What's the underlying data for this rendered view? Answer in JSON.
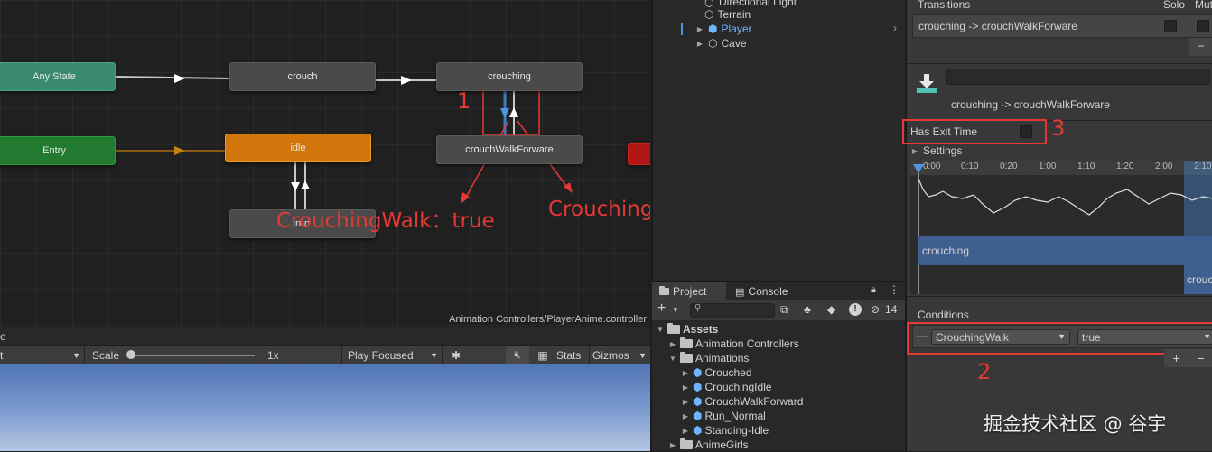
{
  "animator": {
    "path": "Animation Controllers/PlayerAnime.controller",
    "states": {
      "any_state": "Any State",
      "entry": "Entry",
      "crouch": "crouch",
      "idle": "idle",
      "crouching": "crouching",
      "crouch_walk_forward": "crouchWalkForware",
      "run": "run"
    },
    "annotations": {
      "marker_1": "1",
      "label_true": "CrouchingWalk：true",
      "label_false": "CrouchingWalk：false"
    },
    "colors": {
      "annotation": "#e53935",
      "default_state": "#d2760c",
      "any_state": "#3a8a72",
      "entry": "#217a2f"
    }
  },
  "hierarchy": {
    "items": [
      {
        "label": "Directional Light"
      },
      {
        "label": "Terrain"
      },
      {
        "label": "Player",
        "selected": true
      },
      {
        "label": "Cave"
      }
    ]
  },
  "project": {
    "tabs": [
      "Project",
      "Console"
    ],
    "hidden_count": "14",
    "tree": {
      "root": "Assets",
      "folders": [
        "Animation Controllers",
        "Animations",
        "AnimeGirls"
      ],
      "animations": [
        "Crouched",
        "CrouchingIdle",
        "CrouchWalkForward",
        "Run_Normal",
        "Standing-Idle"
      ]
    }
  },
  "inspector": {
    "transitions_header": "Transitions",
    "solo_label": "Solo",
    "mute_label": "Mut",
    "transition_row": "crouching -> crouchWalkForware",
    "transition_name": "crouching -> crouchWalkForware",
    "has_exit_time_label": "Has Exit Time",
    "has_exit_time_checked": false,
    "settings_label": "Settings",
    "timeline_ticks": [
      "0:00",
      "0:10",
      "0:20",
      "1:00",
      "1:10",
      "1:20",
      "2:00",
      "2:10"
    ],
    "clip_from": "crouching",
    "clip_to": "crouc",
    "conditions_header": "Conditions",
    "condition": {
      "parameter": "CrouchingWalk",
      "value": "true"
    },
    "plus_label": "+",
    "minus_label": "−",
    "annotations": {
      "marker_2": "2",
      "marker_3": "3"
    }
  },
  "scene": {
    "toolbar": {
      "scale_label": "Scale",
      "scale_value": "1x",
      "play_mode": "Play Focused",
      "stats_label": "Stats",
      "gizmos_label": "Gizmos"
    }
  },
  "watermark": "掘金技术社区 @ 谷宇"
}
